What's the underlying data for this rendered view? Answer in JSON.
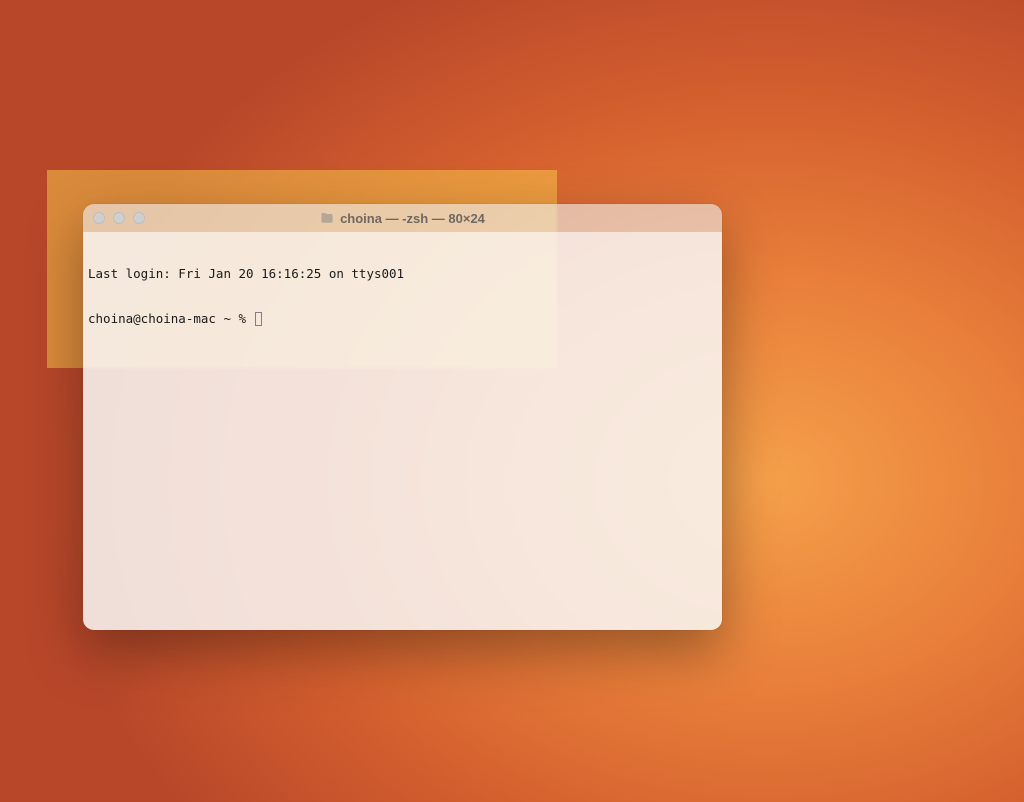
{
  "window": {
    "title": "choina — -zsh — 80×24",
    "icon": "folder-icon"
  },
  "terminal": {
    "last_login_line": "Last login: Fri Jan 20 16:16:25 on ttys001",
    "prompt": "choina@choina-mac ~ % "
  }
}
